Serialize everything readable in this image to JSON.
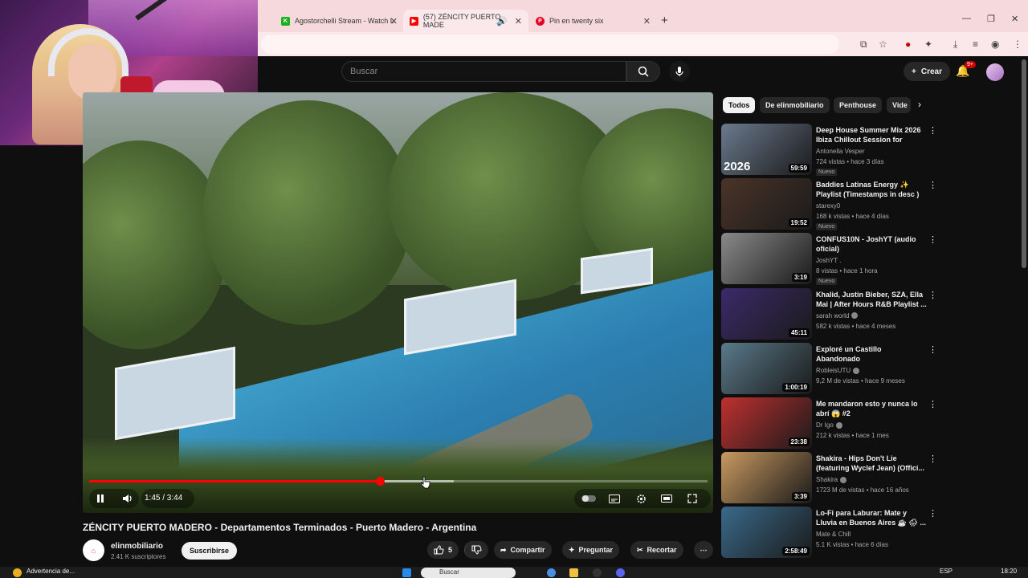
{
  "browser": {
    "tabs": [
      {
        "label": "Agostorchelli Stream - Watch L",
        "favicon_color": "#1ab21a"
      },
      {
        "label": "(57) ZÉNCITY PUERTO MADE",
        "favicon_color": "#ff0000"
      },
      {
        "label": "Pin en twenty six",
        "favicon_color": "#e60023"
      }
    ]
  },
  "youtube": {
    "search_placeholder": "Buscar",
    "create_label": "Crear",
    "notification_count": "9+"
  },
  "player": {
    "progress": 0.47,
    "buffered": 0.59,
    "time_display": "1:45 / 3:44"
  },
  "video": {
    "title": "ZÉNCITY PUERTO MADERO - Departamentos Terminados - Puerto Madero - Argentina",
    "channel_name": "elinmobiliario",
    "subscribers": "2.41 K suscriptores",
    "subscribe_label": "Suscribirse",
    "like_count": "5",
    "share_label": "Compartir",
    "ask_label": "Preguntar",
    "clip_label": "Recortar"
  },
  "sidebar": {
    "chips": [
      "Todos",
      "De elinmobiliario",
      "Penthouse",
      "Vide"
    ],
    "recommendations": [
      {
        "title": "Deep House Summer Mix 2026 Ibiza Chillout Session for Beac...",
        "channel": "Antonella Vesper",
        "meta": "724 vistas • hace 3 días",
        "duration": "59:59",
        "badge": "Nuevo",
        "thumb_text": "2026",
        "verified": false,
        "thumb_color": "#6a7a8e"
      },
      {
        "title": "Baddies Latinas Energy ✨ Playlist (Timestamps in desc )",
        "channel": "starexy0",
        "meta": "168 k vistas • hace 4 días",
        "duration": "19:52",
        "badge": "Nuevo",
        "thumb_text": "",
        "verified": false,
        "thumb_color": "#4a3428"
      },
      {
        "title": "CONFUS10N - JoshYT (audio oficial)",
        "channel": "JoshYT .",
        "meta": "8 vistas • hace 1 hora",
        "duration": "3:19",
        "badge": "Nuevo",
        "thumb_text": "",
        "verified": false,
        "thumb_color": "#8a8a8a"
      },
      {
        "title": "Khalid, Justin Bieber, SZA, Ella Mai | After Hours R&B Playlist ...",
        "channel": "sarah world",
        "meta": "582 k vistas • hace 4 meses",
        "duration": "45:11",
        "badge": "",
        "thumb_text": "",
        "verified": true,
        "thumb_color": "#3b2a6a"
      },
      {
        "title": "Exploré un Castillo Abandonado",
        "channel": "RobleisUTU",
        "meta": "9,2 M de vistas • hace 9 meses",
        "duration": "1:00:19",
        "badge": "",
        "thumb_text": "",
        "verified": true,
        "thumb_color": "#5a7a8a"
      },
      {
        "title": "Me mandaron esto y nunca lo abrí 😱 #2",
        "channel": "Dr Igo",
        "meta": "212 k vistas • hace 1 mes",
        "duration": "23:38",
        "badge": "",
        "thumb_text": "",
        "verified": true,
        "thumb_color": "#c03030"
      },
      {
        "title": "Shakira - Hips Don't Lie (featuring Wyclef Jean) (Offici...",
        "channel": "Shakira",
        "meta": "1723 M de vistas • hace 16 años",
        "duration": "3:39",
        "badge": "",
        "thumb_text": "",
        "verified": true,
        "thumb_color": "#c99a60"
      },
      {
        "title": "Lo-Fi para Laburar: Mate y Lluvia en Buenos Aires ☕ 🌧 ...",
        "channel": "Mate & Chill",
        "meta": "5.1 K vistas • hace 6 días",
        "duration": "2:58:49",
        "badge": "",
        "thumb_text": "",
        "verified": false,
        "thumb_color": "#3a6a8a"
      }
    ]
  },
  "taskbar": {
    "notification_label": "Advertencia de...",
    "search_label": "Buscar",
    "language": "ESP",
    "clock": "18:20"
  }
}
